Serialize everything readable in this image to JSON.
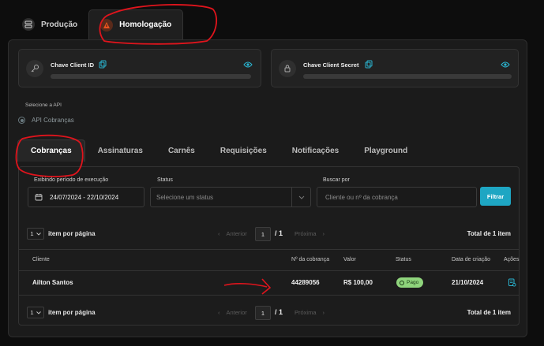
{
  "env_tabs": [
    {
      "label": "Produção",
      "active": false
    },
    {
      "label": "Homologação",
      "active": true
    }
  ],
  "keys": {
    "client_id": {
      "label": "Chave Client ID"
    },
    "client_secret": {
      "label": "Chave Client Secret"
    }
  },
  "api": {
    "label": "Selecione a API",
    "option": "API Cobranças"
  },
  "tabs": [
    "Cobranças",
    "Assinaturas",
    "Carnês",
    "Requisições",
    "Notificações",
    "Playground"
  ],
  "active_tab": "Cobranças",
  "filters": {
    "period_label": "Exibindo período de execução",
    "period_value": "24/07/2024 - 22/10/2024",
    "status_label": "Status",
    "status_placeholder": "Selecione um status",
    "search_label": "Buscar por",
    "search_placeholder": "Cliente ou nº da cobrança",
    "filter_button": "Filtrar"
  },
  "pagination": {
    "page_size": "1",
    "per_page_label": "item por página",
    "prev_label": "Anterior",
    "current_page": "1",
    "total_pages": "/ 1",
    "next_label": "Próxima",
    "total_label": "Total de 1 item"
  },
  "table": {
    "columns": [
      "Cliente",
      "Nº da cobrança",
      "Valor",
      "Status",
      "Data de criação",
      "Ações"
    ],
    "rows": [
      {
        "cliente": "Ailton Santos",
        "numero": "44289056",
        "valor": "R$ 100,00",
        "status": "Pago",
        "data": "21/10/2024"
      }
    ]
  },
  "colors": {
    "accent": "#1ea6c3",
    "paid_badge": "#8fd47c",
    "annotation": "#e0141c",
    "warn_icon": "#e8521f"
  },
  "icons": {
    "producao": "server-icon",
    "homologacao": "flask-warning-icon",
    "client_id": "key-icon",
    "client_secret": "lock-key-icon",
    "copy": "copy-icon",
    "reveal": "eye-icon",
    "calendar": "calendar-icon",
    "action": "receipt-icon"
  }
}
